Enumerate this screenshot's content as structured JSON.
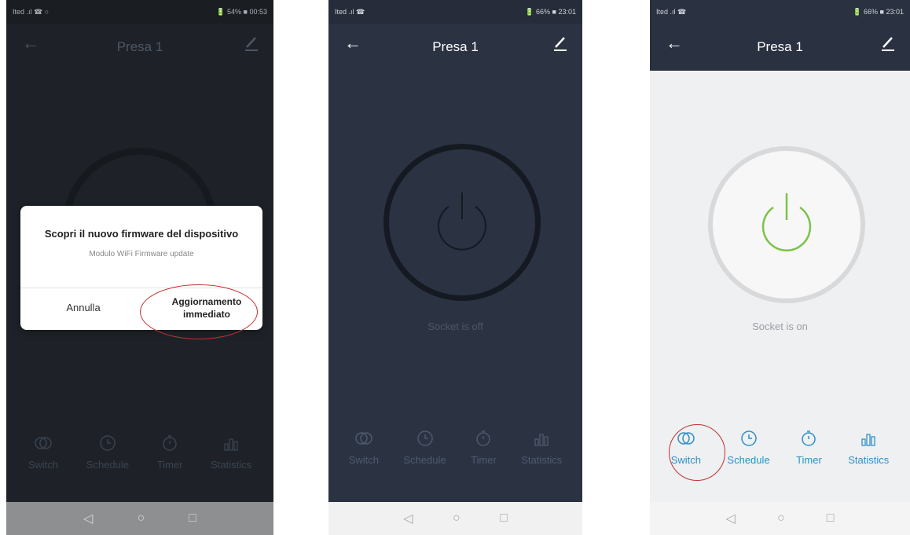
{
  "colors": {
    "accent_blue": "#2f8fc8",
    "power_on_green": "#7cc24a",
    "highlight_red": "#c0322f",
    "dark_bg": "#2b3242"
  },
  "phones": [
    {
      "status_left": "Ited .ıl ☎ ○",
      "status_right": "🔋 54% ■ 00:53",
      "title": "Presa 1",
      "icons": {
        "back": "arrow-left-icon",
        "edit": "pencil-icon"
      },
      "dialog": {
        "title": "Scopri il nuovo firmware del dispositivo",
        "subtitle": "Modulo WiFi Firmware update",
        "cancel_label": "Annulla",
        "confirm_label": "Aggiornamento immediato"
      },
      "tabs": [
        "Switch",
        "Schedule",
        "Timer",
        "Statistics"
      ],
      "nav": [
        "◁",
        "○",
        "□"
      ]
    },
    {
      "status_left": "Ited .ıl ☎",
      "status_right": "🔋 66% ■ 23:01",
      "title": "Presa 1",
      "icons": {
        "back": "arrow-left-icon",
        "edit": "pencil-icon"
      },
      "state": "Socket is off",
      "tabs": [
        "Switch",
        "Schedule",
        "Timer",
        "Statistics"
      ],
      "nav": [
        "◁",
        "○",
        "□"
      ]
    },
    {
      "status_left": "Ited .ıl ☎",
      "status_right": "🔋 66% ■ 23:01",
      "title": "Presa 1",
      "icons": {
        "back": "arrow-left-icon",
        "edit": "pencil-icon"
      },
      "state": "Socket is on",
      "tabs": [
        "Switch",
        "Schedule",
        "Timer",
        "Statistics"
      ],
      "nav": [
        "◁",
        "○",
        "□"
      ]
    }
  ]
}
